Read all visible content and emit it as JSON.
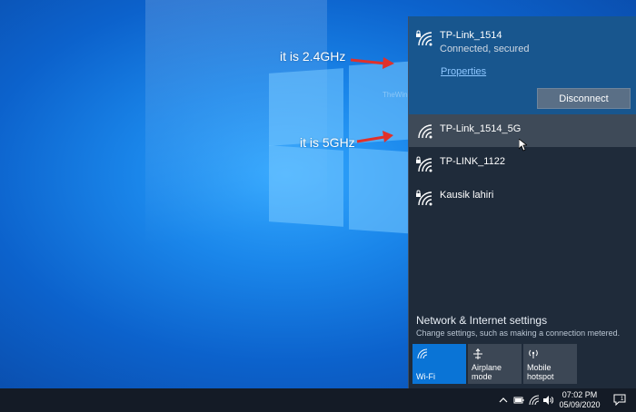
{
  "annotations": {
    "label_24": "it is 2.4GHz",
    "label_5": "it is 5GHz",
    "watermark": "TheWindowsClub"
  },
  "networks": [
    {
      "name": "TP-Link_1514",
      "status": "Connected, secured",
      "secured": true
    },
    {
      "name": "TP-Link_1514_5G",
      "secured": false
    },
    {
      "name": "TP-LINK_1122",
      "secured": true
    },
    {
      "name": "Kausik lahiri",
      "secured": true
    }
  ],
  "connected_actions": {
    "properties_label": "Properties",
    "disconnect_label": "Disconnect"
  },
  "settings": {
    "title": "Network & Internet settings",
    "subtitle": "Change settings, such as making a connection metered."
  },
  "quick_actions": [
    {
      "label": "Wi-Fi",
      "icon": "wifi-icon",
      "active": true
    },
    {
      "label": "Airplane mode",
      "icon": "airplane-icon",
      "active": false
    },
    {
      "label": "Mobile hotspot",
      "icon": "hotspot-icon",
      "active": false
    }
  ],
  "taskbar": {
    "time": "07:02 PM",
    "date": "05/09/2020",
    "notification_count": "1"
  },
  "colors": {
    "flyout_bg": "#1f2b3a",
    "connected_bg": "#18568e",
    "active_tile": "#0a74d6",
    "annotation_arrow": "#e0312b"
  }
}
